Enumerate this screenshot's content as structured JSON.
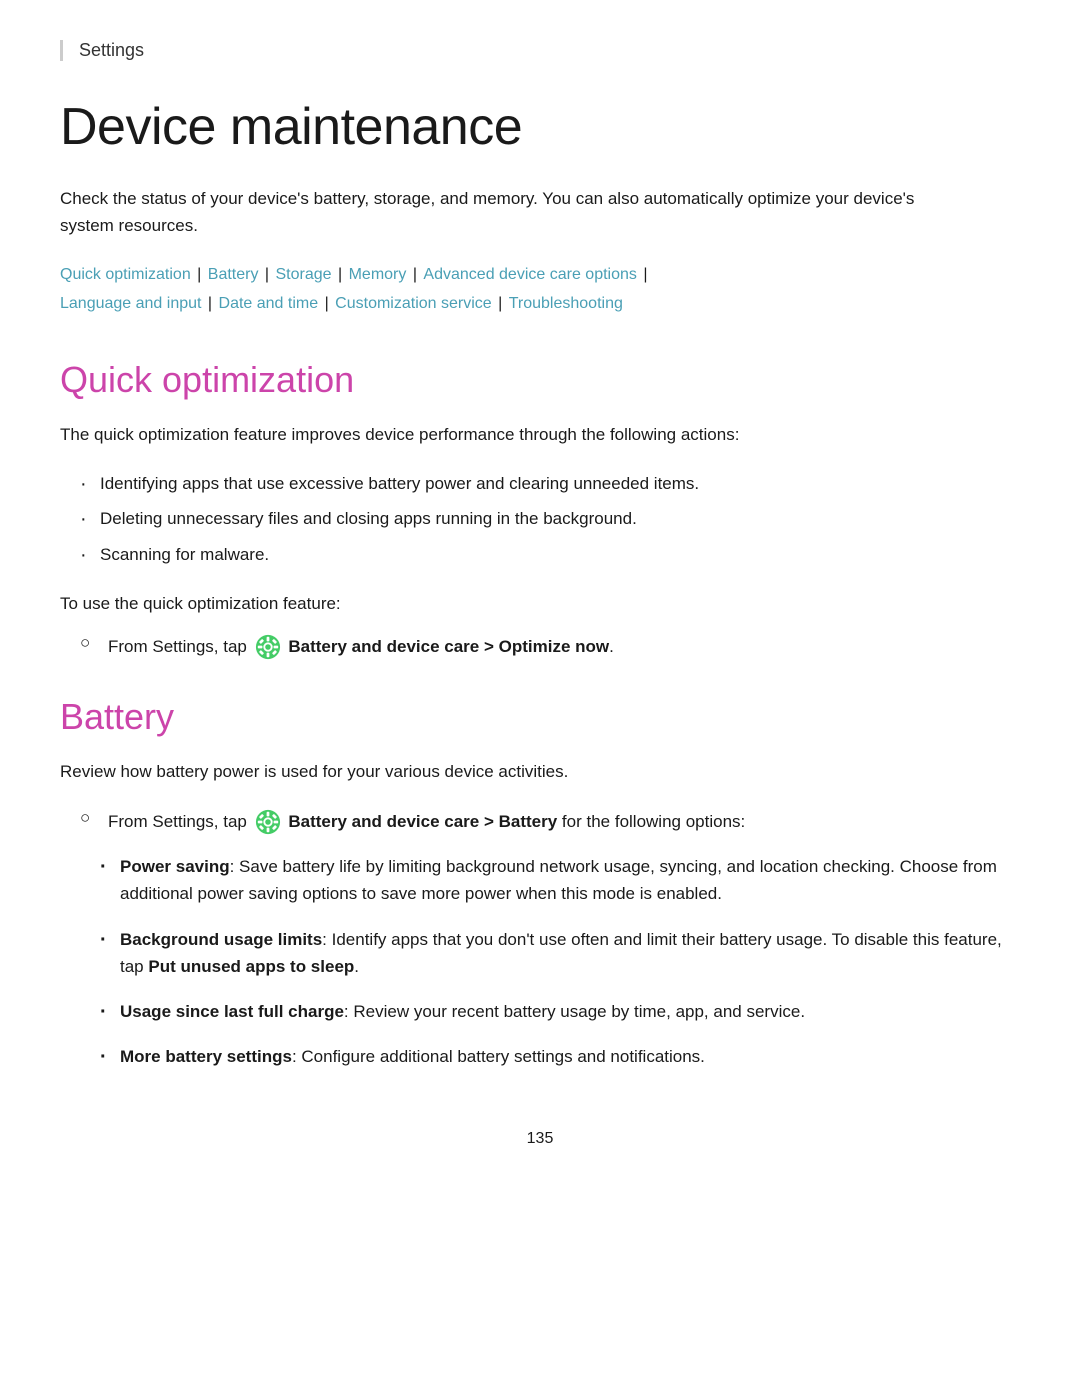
{
  "breadcrumb": {
    "label": "Settings"
  },
  "page": {
    "title": "Device maintenance",
    "intro": "Check the status of your device's battery, storage, and memory. You can also automatically optimize your device's system resources."
  },
  "nav": {
    "links": [
      {
        "label": "Quick optimization",
        "separator": true
      },
      {
        "label": "Battery",
        "separator": true
      },
      {
        "label": "Storage",
        "separator": true
      },
      {
        "label": "Memory",
        "separator": true
      },
      {
        "label": "Advanced device care options",
        "separator": true
      },
      {
        "label": "Language and input",
        "separator": true
      },
      {
        "label": "Date and time",
        "separator": true
      },
      {
        "label": "Customization service",
        "separator": true
      },
      {
        "label": "Troubleshooting",
        "separator": false
      }
    ]
  },
  "sections": {
    "quick_optimization": {
      "heading": "Quick optimization",
      "intro": "The quick optimization feature improves device performance through the following actions:",
      "bullets": [
        "Identifying apps that use excessive battery power and clearing unneeded items.",
        "Deleting unnecessary files and closing apps running in the background.",
        "Scanning for malware."
      ],
      "step_intro": "To use the quick optimization feature:",
      "step": "From Settings, tap",
      "step_bold": "Battery and device care > Optimize now",
      "step_end": "."
    },
    "battery": {
      "heading": "Battery",
      "intro": "Review how battery power is used for your various device activities.",
      "step": "From Settings, tap",
      "step_bold": "Battery and device care > Battery",
      "step_mid": "for the following options:",
      "options": [
        {
          "label": "Power saving",
          "text": ": Save battery life by limiting background network usage, syncing, and location checking. Choose from additional power saving options to save more power when this mode is enabled."
        },
        {
          "label": "Background usage limits",
          "text": ": Identify apps that you don't use often and limit their battery usage. To disable this feature, tap",
          "bold_end": "Put unused apps to sleep",
          "text_end": "."
        },
        {
          "label": "Usage since last full charge",
          "text": ": Review your recent battery usage by time, app, and service."
        },
        {
          "label": "More battery settings",
          "text": ": Configure additional battery settings and notifications."
        }
      ]
    }
  },
  "page_number": "135"
}
